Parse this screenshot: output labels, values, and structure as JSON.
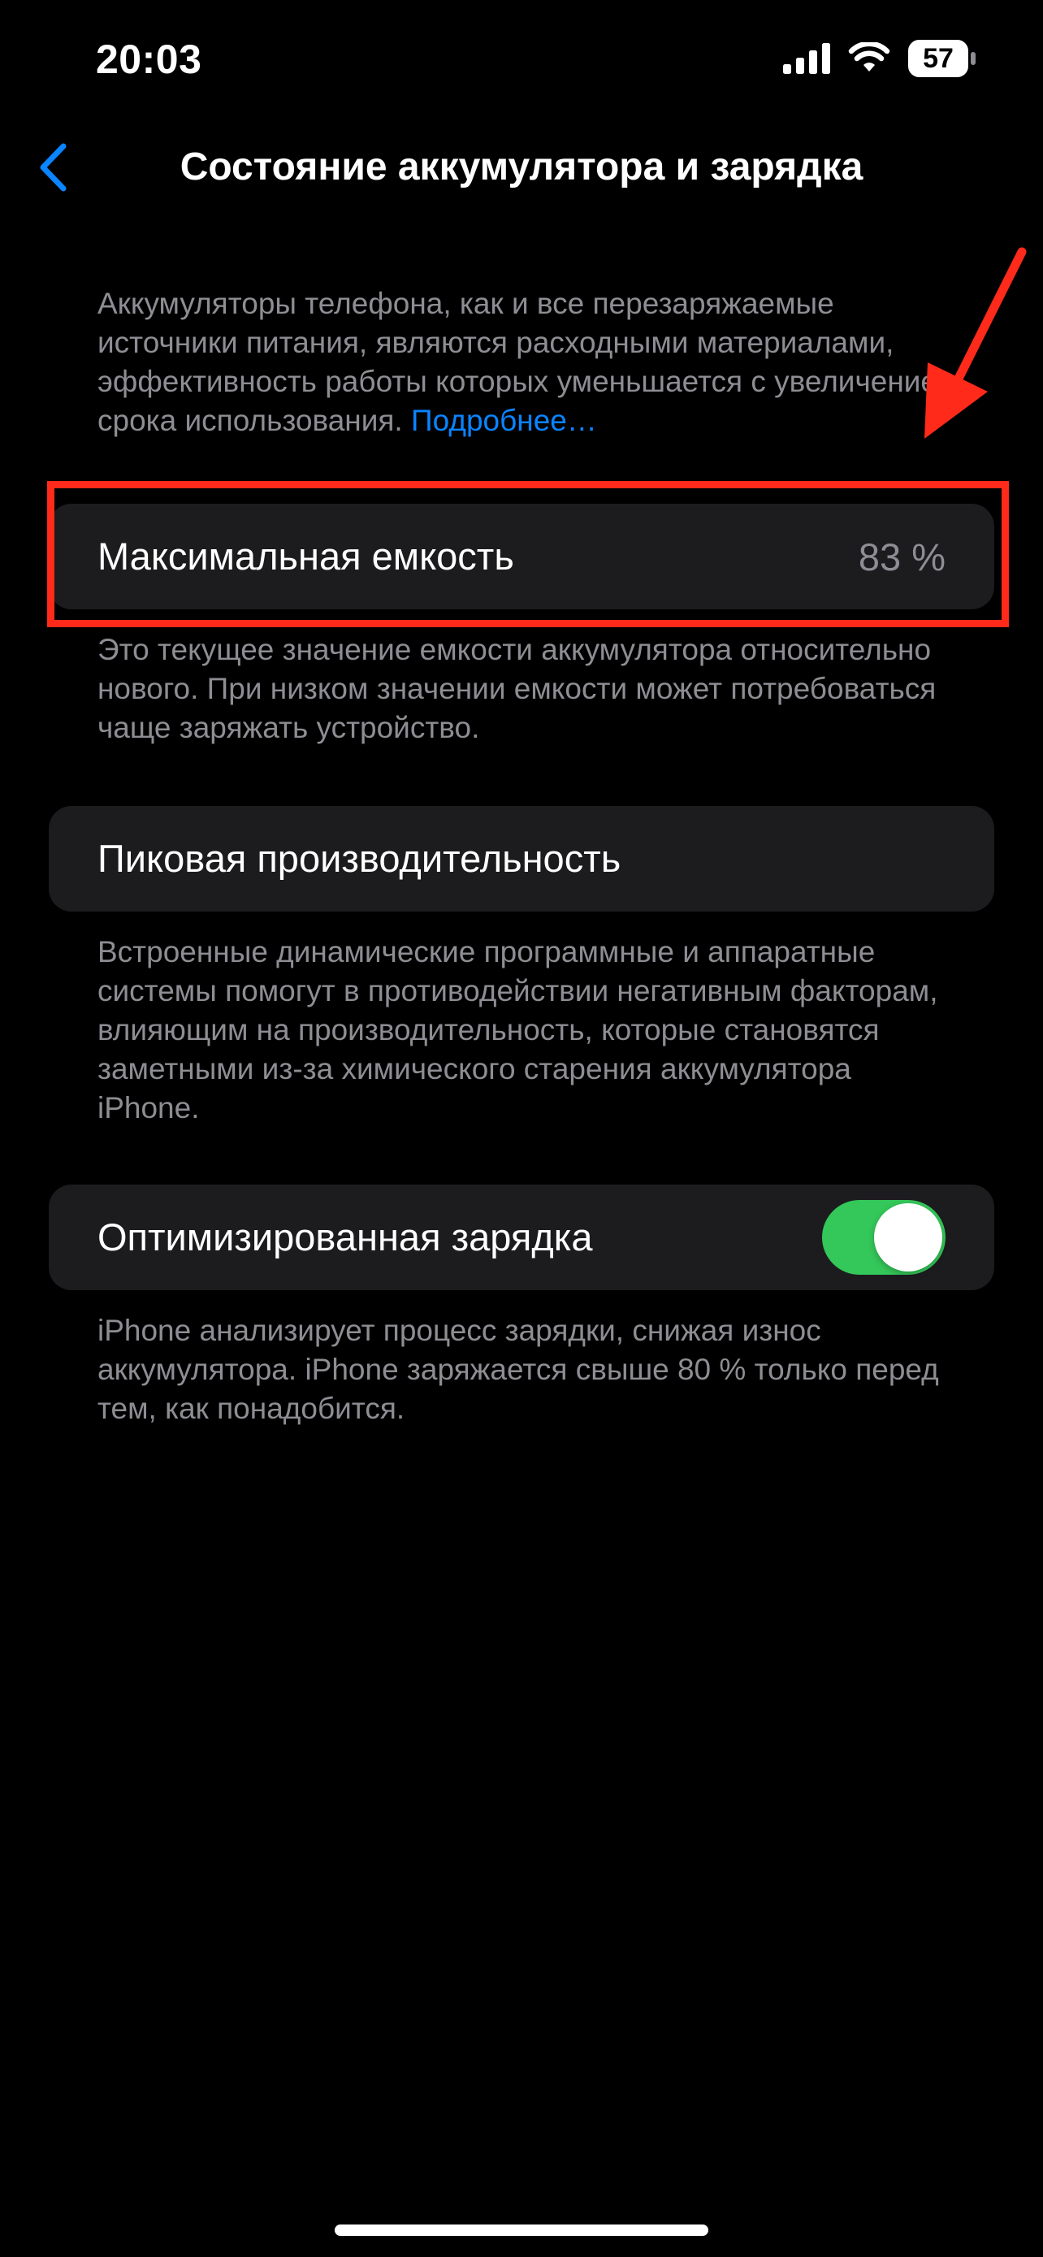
{
  "status_bar": {
    "time": "20:03",
    "battery_level": "57",
    "icons": [
      "signal-icon",
      "wifi-icon",
      "battery-icon"
    ]
  },
  "nav": {
    "back_icon": "chevron-left-icon",
    "title": "Состояние аккумулятора и зарядка"
  },
  "intro": {
    "text": "Аккумуляторы телефона, как и все перезаряжаемые источники питания, являются расходными материалами, эффективность работы которых уменьшается с увеличением срока использования. ",
    "link": "Подробнее…"
  },
  "max_capacity": {
    "label": "Максимальная емкость",
    "value": "83 %",
    "footnote": "Это текущее значение емкости аккумулятора относительно нового. При низком значении емкости может потребоваться чаще заряжать устройство."
  },
  "peak_performance": {
    "label": "Пиковая производительность",
    "footnote": "Встроенные динамические программные и аппаратные системы помогут в противодействии негативным факторам, влияющим на производительность, которые становятся заметными из-за химического старения аккумулятора iPhone."
  },
  "optimized_charging": {
    "label": "Оптимизированная зарядка",
    "enabled": true,
    "footnote": "iPhone анализирует процесс зарядки, снижая износ аккумулятора. iPhone заряжается свыше 80 % только перед тем, как понадобится."
  },
  "colors": {
    "background": "#000000",
    "cell": "#1c1c1e",
    "secondary_text": "#8d8d93",
    "link": "#0a84ff",
    "toggle_on": "#34c759",
    "annotation": "#ff2a1a"
  }
}
